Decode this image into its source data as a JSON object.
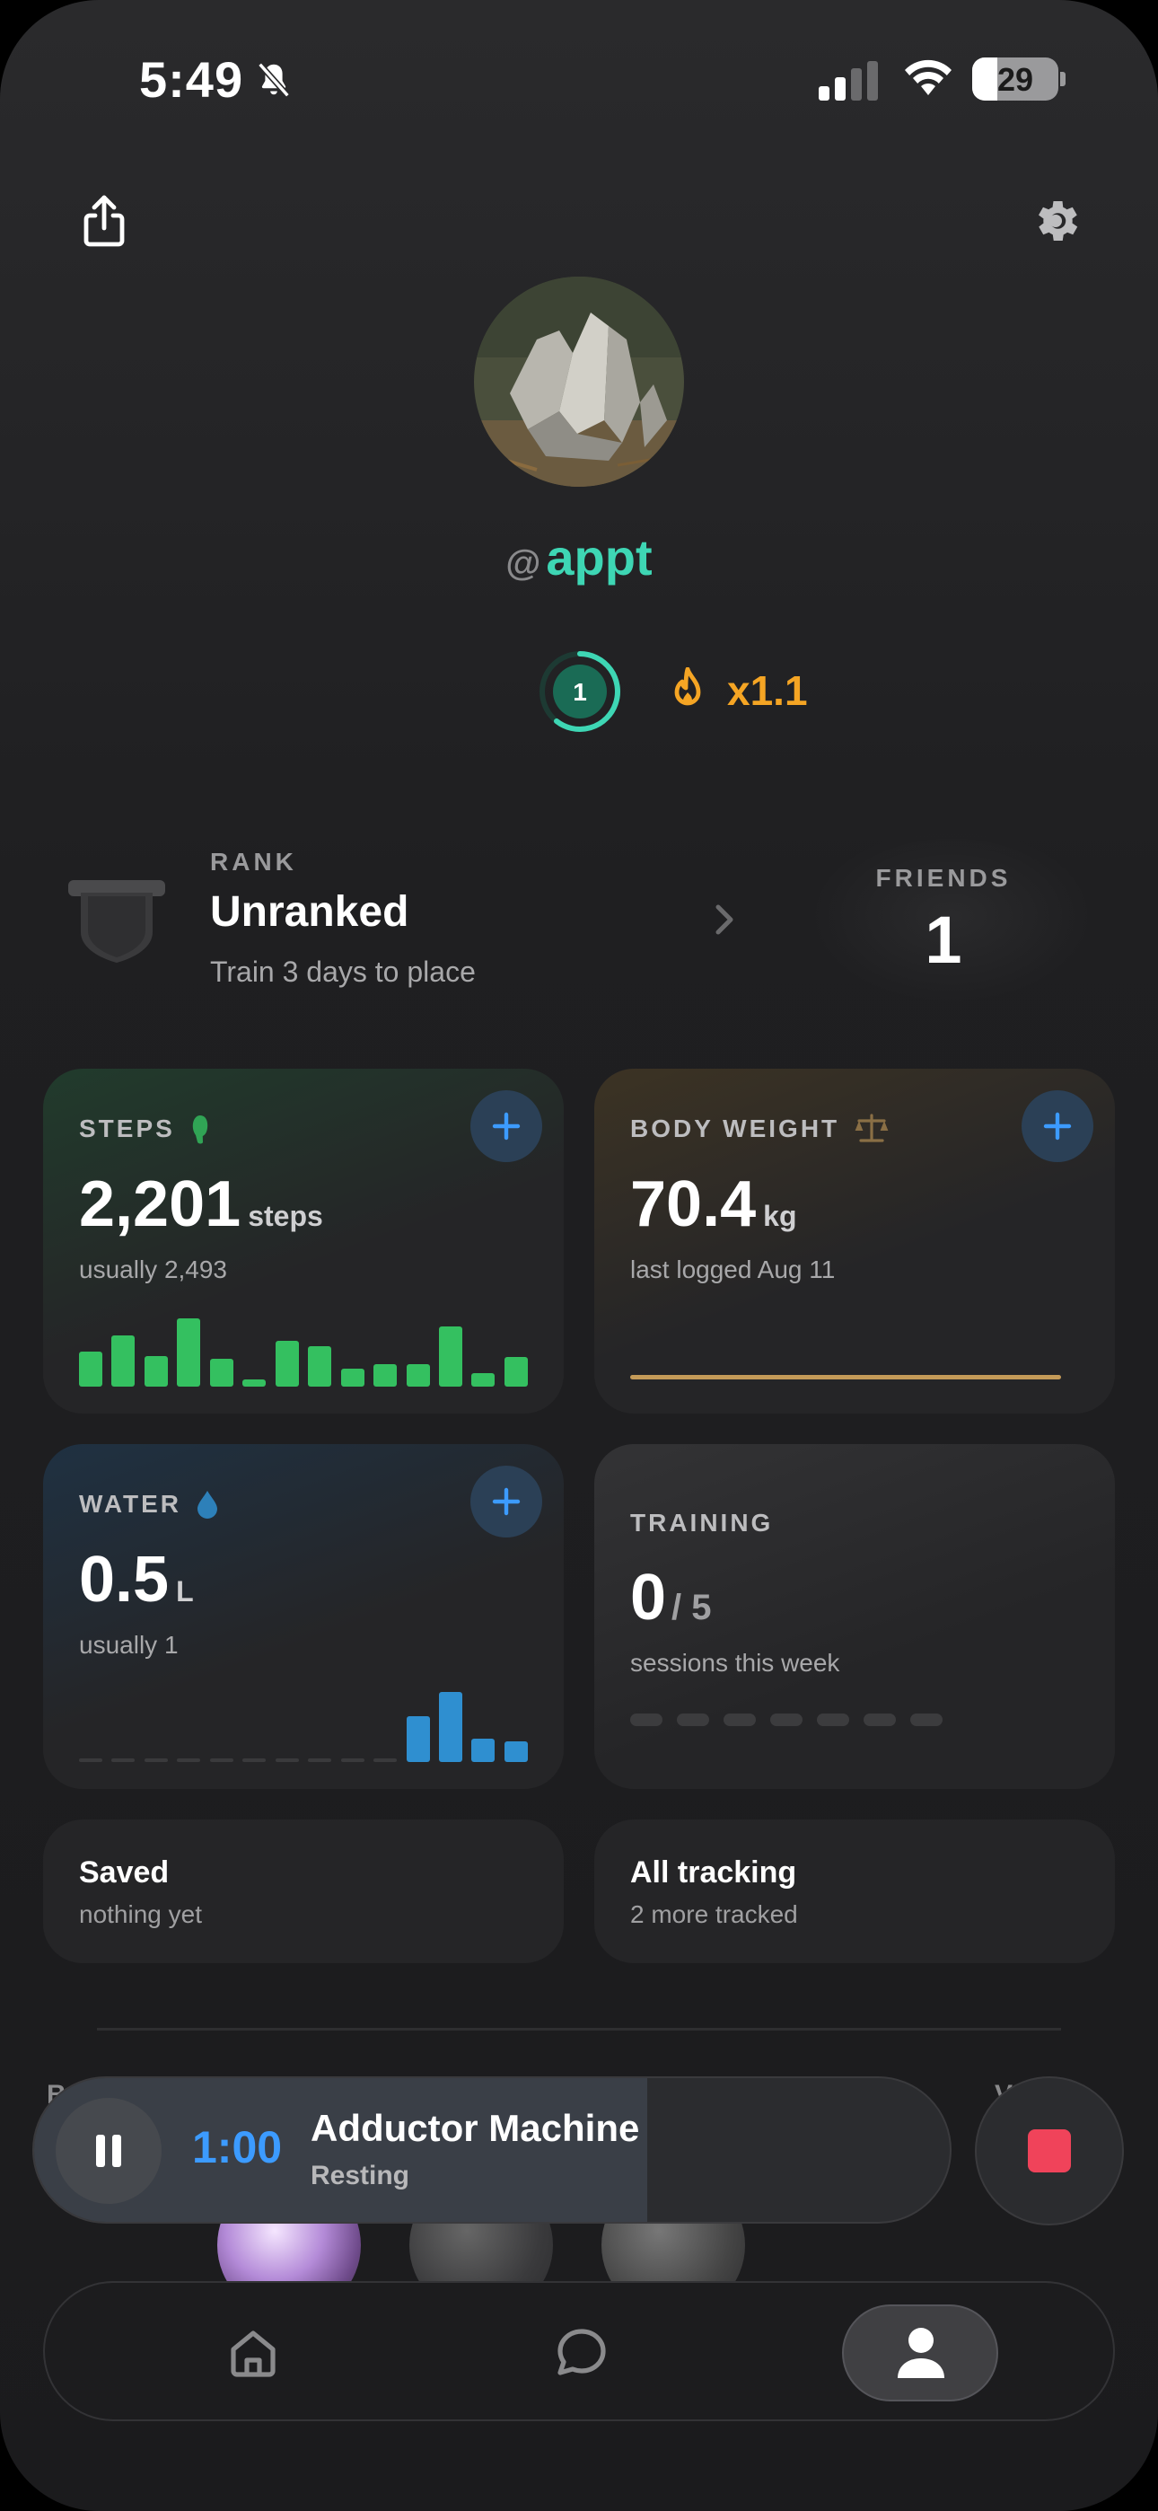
{
  "status_bar": {
    "time": "5:49",
    "battery": "29"
  },
  "profile": {
    "at_symbol": "@",
    "username": "appt",
    "level": "1",
    "streak_multiplier": "x1.1"
  },
  "rank": {
    "label": "RANK",
    "value": "Unranked",
    "subtitle": "Train 3 days to place"
  },
  "friends": {
    "label": "FRIENDS",
    "count": "1"
  },
  "steps_card": {
    "label": "STEPS",
    "value": "2,201",
    "unit": "steps",
    "subtitle": "usually 2,493",
    "accent": "#34c060",
    "bar_values": [
      0.5,
      0.73,
      0.43,
      0.98,
      0.4,
      0.1,
      0.66,
      0.58,
      0.26,
      0.32,
      0.32,
      0.86,
      0.19,
      0.42
    ]
  },
  "weight_card": {
    "label": "BODY WEIGHT",
    "value": "70.4",
    "unit": "kg",
    "subtitle": "last logged Aug 11",
    "accent": "#c49a58"
  },
  "water_card": {
    "label": "WATER",
    "value": "0.5",
    "unit": "L",
    "subtitle": "usually 1",
    "accent": "#2f8fd0",
    "bar_values": [
      0,
      0,
      0,
      0,
      0,
      0,
      0,
      0,
      0,
      0,
      0.65,
      1.0,
      0.33,
      0.3
    ]
  },
  "training_card": {
    "label": "TRAINING",
    "value": "0",
    "goal": "5",
    "subtitle": "sessions this week",
    "days": 7
  },
  "saved_card": {
    "title": "Saved",
    "subtitle": "nothing yet"
  },
  "all_tracking_card": {
    "title": "All tracking",
    "subtitle": "2 more tracked"
  },
  "peek": {
    "left_text": "B",
    "right_text": "V ll"
  },
  "player": {
    "time": "1:00",
    "exercise": "Adductor Machine",
    "status": "Resting",
    "progress": 0.67,
    "accent": "#3c9bff"
  },
  "tabs": [
    "home",
    "chat",
    "profile"
  ],
  "active_tab": "profile"
}
